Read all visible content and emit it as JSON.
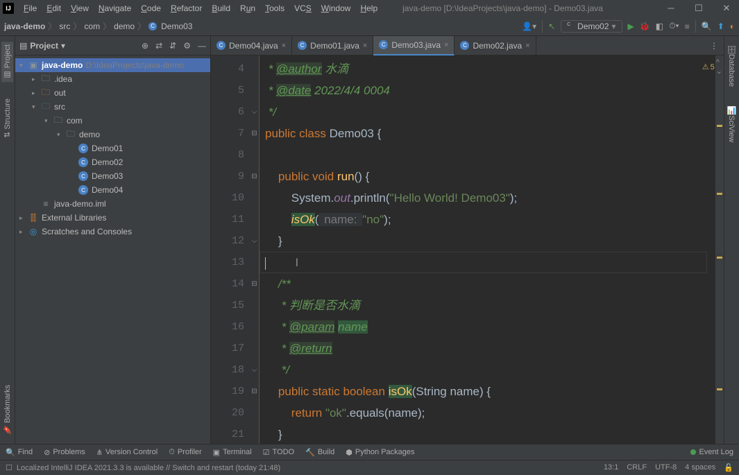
{
  "window": {
    "title": "java-demo [D:\\IdeaProjects\\java-demo] - Demo03.java"
  },
  "menu": {
    "file": "File",
    "edit": "Edit",
    "view": "View",
    "navigate": "Navigate",
    "code": "Code",
    "refactor": "Refactor",
    "build": "Build",
    "run": "Run",
    "tools": "Tools",
    "vcs": "VCS",
    "window": "Window",
    "help": "Help"
  },
  "breadcrumb": {
    "project": "java-demo",
    "src": "src",
    "pkg1": "com",
    "pkg2": "demo",
    "cls": "Demo03"
  },
  "runConfig": {
    "name": "Demo02"
  },
  "leftTabs": {
    "project": "Project",
    "structure": "Structure",
    "bookmarks": "Bookmarks"
  },
  "rightTabs": {
    "database": "Database",
    "sciview": "SciView"
  },
  "projectTool": {
    "title": "Project"
  },
  "tree": {
    "root": "java-demo",
    "rootPath": "D:\\IdeaProjects\\java-demo",
    "idea": ".idea",
    "out": "out",
    "src": "src",
    "com": "com",
    "demo": "demo",
    "d1": "Demo01",
    "d2": "Demo02",
    "d3": "Demo03",
    "d4": "Demo04",
    "iml": "java-demo.iml",
    "ext": "External Libraries",
    "scratch": "Scratches and Consoles"
  },
  "tabs": {
    "t1": "Demo04.java",
    "t2": "Demo01.java",
    "t3": "Demo03.java",
    "t4": "Demo02.java"
  },
  "warnings": {
    "count": "5"
  },
  "code": {
    "l4_tag": "@author",
    "l4_txt": " 水滴",
    "l5_tag": "@date",
    "l5_txt": " 2022/4/4 0004",
    "l7_cls": "Demo03",
    "l9_fn": "run",
    "l10_str": "\"Hello World! Demo03\"",
    "l11_fn": "isOk",
    "l11_hint": " name: ",
    "l11_str": "\"no\"",
    "l15_txt": " 判断是否水滴",
    "l16_tag": "@param",
    "l16_p": "name",
    "l17_tag": "@return",
    "l19_fn": "isOk",
    "l20_str": "\"ok\""
  },
  "bottomTools": {
    "find": "Find",
    "problems": "Problems",
    "vcs": "Version Control",
    "profiler": "Profiler",
    "terminal": "Terminal",
    "todo": "TODO",
    "build": "Build",
    "python": "Python Packages",
    "eventlog": "Event Log"
  },
  "status": {
    "message": "Localized IntelliJ IDEA 2021.3.3 is available // Switch and restart (today 21:48)",
    "pos": "13:1",
    "sep": "CRLF",
    "enc": "UTF-8",
    "indent": "4 spaces"
  }
}
